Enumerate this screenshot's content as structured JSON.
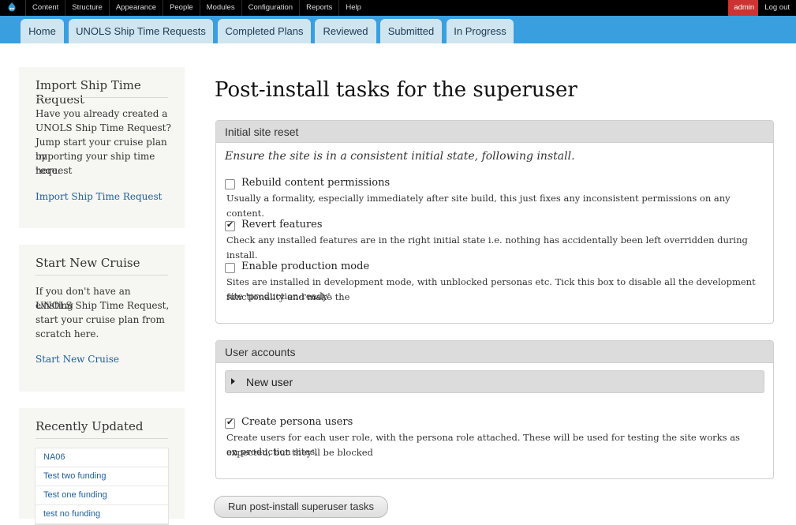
{
  "admin_bar": {
    "menu": [
      "Content",
      "Structure",
      "Appearance",
      "People",
      "Modules",
      "Configuration",
      "Reports",
      "Help"
    ],
    "user": "admin",
    "logout": "Log out"
  },
  "tabs": [
    "Home",
    "UNOLS Ship Time Requests",
    "Completed Plans",
    "Reviewed",
    "Submitted",
    "In Progress"
  ],
  "sidebar": {
    "import": {
      "title": "Import Ship Time Request",
      "lines": [
        "Have you already created a",
        "UNOLS Ship Time Request?",
        "Jump start your cruise plan by",
        "importing your ship time request",
        "here."
      ],
      "link": "Import Ship Time Request"
    },
    "start": {
      "title": "Start New Cruise",
      "lines": [
        "If you don't have an existing",
        "UNOLS Ship Time Request,",
        "start your cruise plan from",
        "scratch here."
      ],
      "link": "Start New Cruise"
    },
    "recent": {
      "title": "Recently Updated",
      "items": [
        "NA06",
        "Test two funding",
        "Test one funding",
        "test no funding"
      ]
    }
  },
  "page_title": "Post-install tasks for the superuser",
  "site_reset": {
    "legend": "Initial site reset",
    "description": "Ensure the site is in a consistent initial state, following install.",
    "options": [
      {
        "label": "Rebuild content permissions",
        "checked": false,
        "desc_lines": [
          "Usually a formality, especially immediately after site build, this just fixes any inconsistent permissions on any content."
        ]
      },
      {
        "label": "Revert features",
        "checked": true,
        "desc_lines": [
          "Check any installed features are in the right initial state i.e. nothing has accidentally been left overridden during install."
        ]
      },
      {
        "label": "Enable production mode",
        "checked": false,
        "desc_lines": [
          "Sites are installed in development mode, with unblocked personas etc. Tick this box to disable all the development functionality and make the",
          "site 'production-ready'."
        ]
      }
    ]
  },
  "user_accounts": {
    "legend": "User accounts",
    "new_user": "New user",
    "persona": {
      "label": "Create persona users",
      "checked": true,
      "desc_lines": [
        "Create users for each user role, with the persona role attached. These will be used for testing the site works as expected, but they'll be blocked",
        "on production sites."
      ]
    }
  },
  "submit": "Run post-install superuser tasks"
}
